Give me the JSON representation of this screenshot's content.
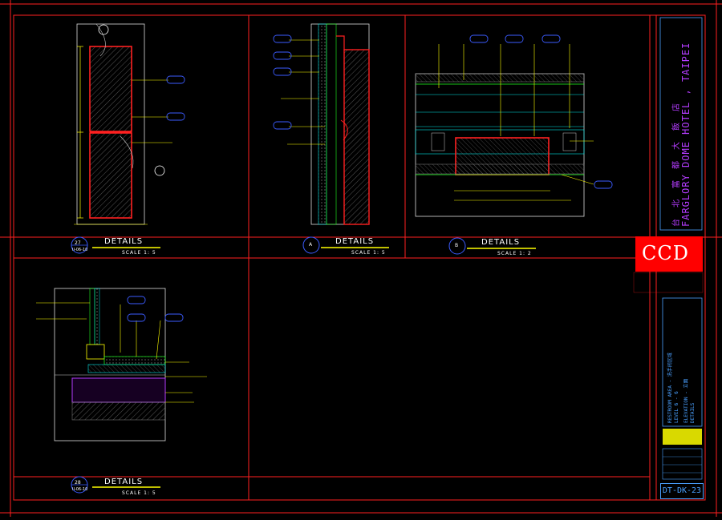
{
  "sheet": {
    "hotel_name_cn": "台　北　富　都　大　飯　店",
    "hotel_name_en": "FARGLORY DOME HOTEL , TAIPEI",
    "company": "CCD",
    "sheet_number": "DT-DK-23",
    "area": "RESTROOM AREA - 洗手间区域",
    "level": "LEVEL 6 - 6",
    "elevation_title": "ELEVATION - 立面",
    "sheet_kind": "DETAILS"
  },
  "details": [
    {
      "id": "27",
      "sub": "II-06-10",
      "title": "DETAILS",
      "scale": "SCALE 1:  5"
    },
    {
      "id": "A",
      "sub": "",
      "title": "DETAILS",
      "scale": "SCALE 1:  5"
    },
    {
      "id": "B",
      "sub": "",
      "title": "DETAILS",
      "scale": "SCALE 1:  2"
    },
    {
      "id": "28",
      "sub": "II-06-10",
      "title": "DETAILS",
      "scale": "SCALE 1:  5"
    }
  ],
  "colors": {
    "frame": "#ff1f1f",
    "wall": "#ffffff",
    "hatch": "#8a8a8a",
    "callout": "#ffff00",
    "tag_circle": "#3b5bff",
    "cyan": "#00e5e5",
    "green": "#22ff22",
    "magenta": "#b43cff",
    "titleblock": "#4aa0ff"
  }
}
